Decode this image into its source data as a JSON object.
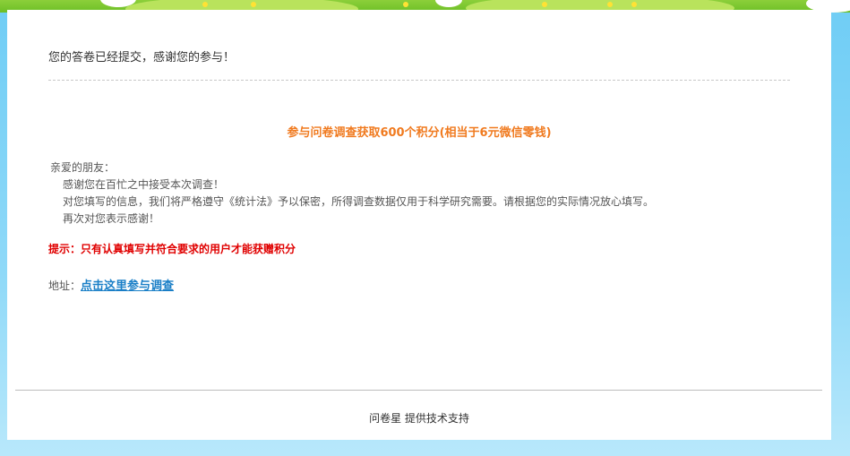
{
  "submission_message": "您的答卷已经提交，感谢您的参与！",
  "headline": "参与问卷调查获取600个积分(相当于6元微信零钱)",
  "greeting": "亲爱的朋友：",
  "paragraphs": [
    "感谢您在百忙之中接受本次调查！",
    "对您填写的信息，我们将严格遵守《统计法》予以保密，所得调查数据仅用于科学研究需要。请根据您的实际情况放心填写。",
    "再次对您表示感谢！"
  ],
  "tip": "提示：只有认真填写并符合要求的用户才能获赠积分",
  "address_label": "地址：",
  "address_link": "点击这里参与调查",
  "footer": "问卷星 提供技术支持",
  "colors": {
    "headline": "#f07a1f",
    "tip": "#e00000",
    "link": "#1a7fc7",
    "background": "#6fcdf5"
  }
}
